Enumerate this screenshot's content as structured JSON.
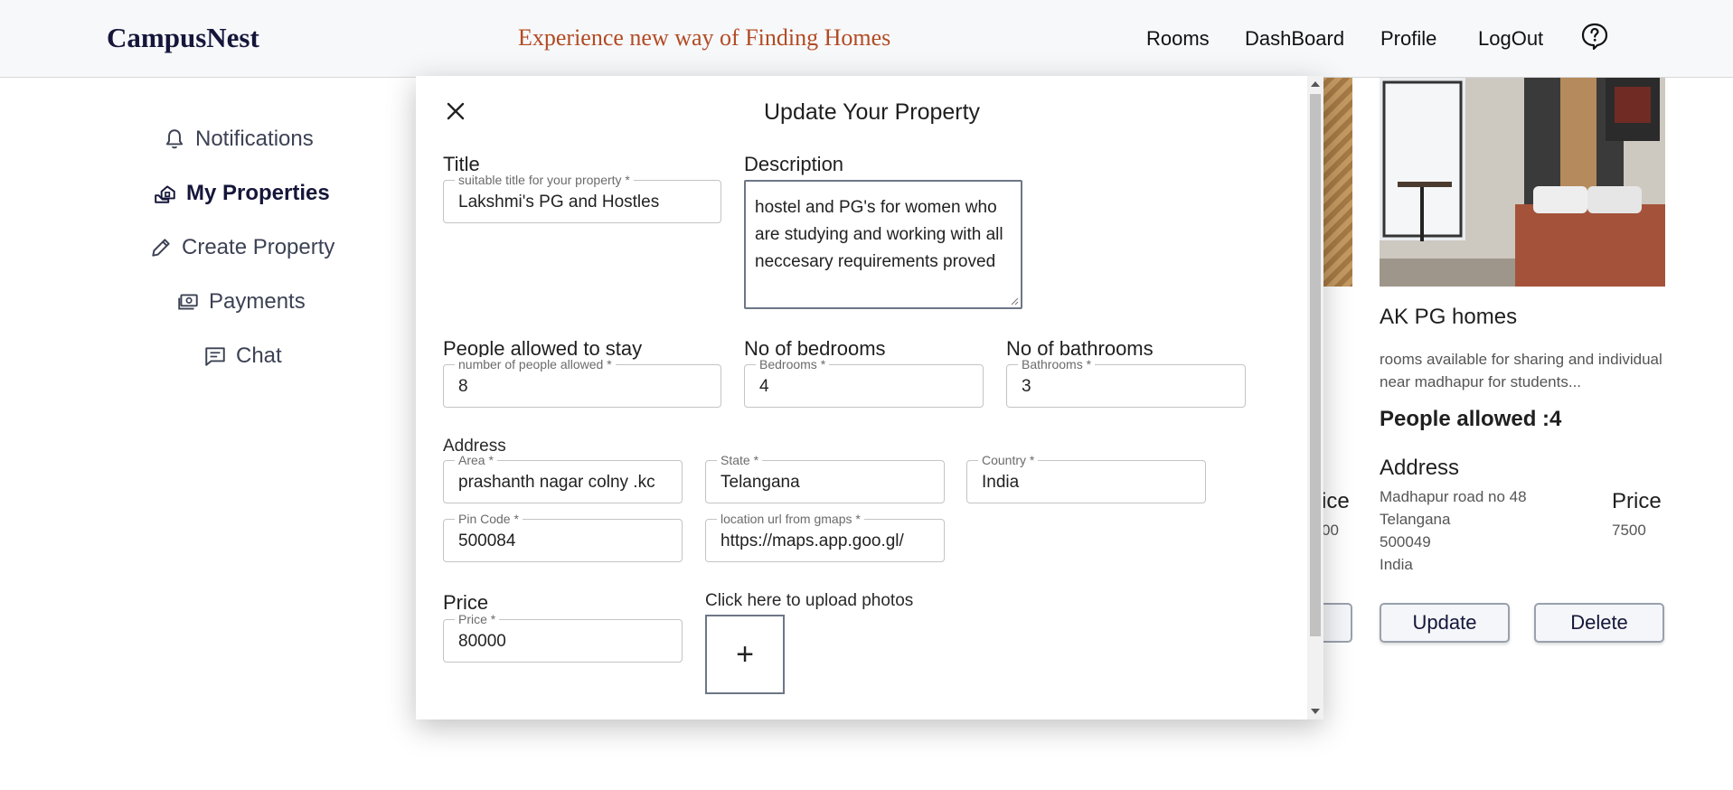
{
  "header": {
    "brand": "CampusNest",
    "tagline": "Experience new way of Finding Homes",
    "nav": [
      "Rooms",
      "DashBoard",
      "Profile",
      "LogOut"
    ],
    "help_icon": "help-circle-icon"
  },
  "sidebar": {
    "items": [
      {
        "label": "Notifications",
        "icon": "bell-icon"
      },
      {
        "label": "My Properties",
        "icon": "house-hand-icon",
        "active": true
      },
      {
        "label": "Create Property",
        "icon": "pencil-icon"
      },
      {
        "label": "Payments",
        "icon": "money-icon"
      },
      {
        "label": "Chat",
        "icon": "chat-icon"
      }
    ]
  },
  "card": {
    "title": "AK PG homes",
    "description": "rooms available for sharing and individual near madhapur for students...",
    "people": "People allowed :4",
    "address_heading": "Address",
    "address_lines": [
      "Madhapur road no 48",
      "Telangana",
      "500049",
      "India"
    ],
    "price_heading": "Price",
    "price": "7500",
    "update_label": "Update",
    "delete_label": "Delete"
  },
  "partial_card": {
    "price_heading_fragment": "ice",
    "price_fragment": "00"
  },
  "modal": {
    "title": "Update Your Property",
    "title_label": "Title",
    "title_field": {
      "label": "suitable title for your property *",
      "value": "Lakshmi's PG and Hostles"
    },
    "description_label": "Description",
    "description_value": "hostel and PG's for women who are studying and working with all neccesary requirements proved",
    "people_label": "People allowed to stay",
    "people_field": {
      "label": "number of people allowed *",
      "value": "8"
    },
    "bedrooms_label": "No of bedrooms",
    "bedrooms_field": {
      "label": "Bedrooms *",
      "value": "4"
    },
    "bathrooms_label": "No of bathrooms",
    "bathrooms_field": {
      "label": "Bathrooms *",
      "value": "3"
    },
    "address_label": "Address",
    "area_field": {
      "label": "Area *",
      "value": "prashanth nagar colny .kc"
    },
    "state_field": {
      "label": "State *",
      "value": "Telangana"
    },
    "country_field": {
      "label": "Country *",
      "value": "India"
    },
    "pincode_field": {
      "label": "Pin Code *",
      "value": "500084"
    },
    "location_field": {
      "label": "location url from gmaps *",
      "value": "https://maps.app.goo.gl/"
    },
    "price_label": "Price",
    "price_field": {
      "label": "Price *",
      "value": "80000"
    },
    "upload_label": "Click here to upload photos",
    "upload_plus": "+"
  }
}
